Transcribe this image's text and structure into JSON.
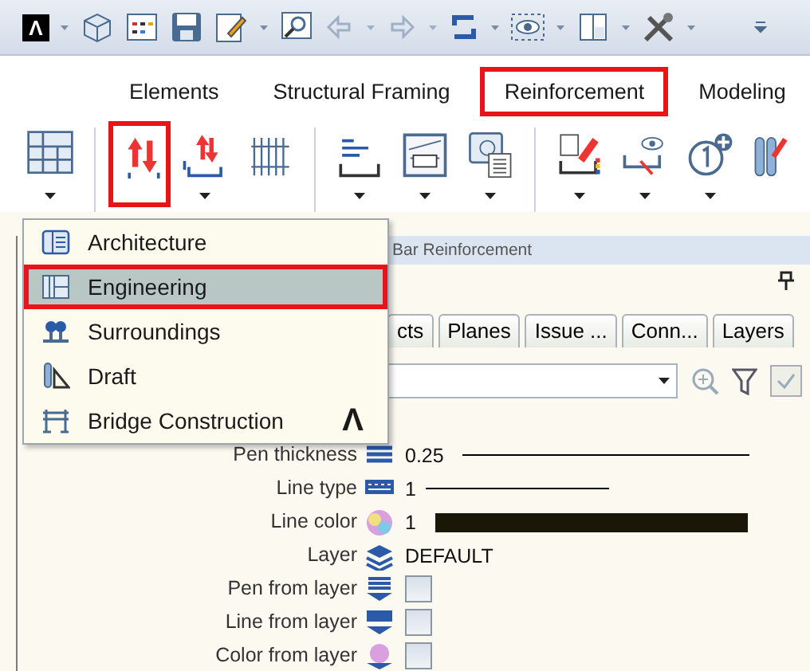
{
  "quick_access": {
    "logo": "Λ"
  },
  "tabs": [
    {
      "label": "Elements",
      "highlighted": false
    },
    {
      "label": "Structural Framing",
      "highlighted": false
    },
    {
      "label": "Reinforcement",
      "highlighted": true
    },
    {
      "label": "Modeling",
      "highlighted": false
    }
  ],
  "tool_groups": [
    [
      {
        "kind": "frame",
        "dropdown": true,
        "highlighted": false
      }
    ],
    [
      {
        "kind": "bars",
        "dropdown": false,
        "highlighted": true
      },
      {
        "kind": "bars-tray",
        "dropdown": true,
        "highlighted": false
      },
      {
        "kind": "mesh",
        "dropdown": false,
        "highlighted": false
      }
    ],
    [
      {
        "kind": "label",
        "dropdown": true,
        "highlighted": false
      },
      {
        "kind": "dimension",
        "dropdown": true,
        "highlighted": false
      },
      {
        "kind": "view",
        "dropdown": true,
        "highlighted": false
      }
    ],
    [
      {
        "kind": "edit",
        "dropdown": true,
        "highlighted": false
      },
      {
        "kind": "eye",
        "dropdown": true,
        "highlighted": false
      },
      {
        "kind": "number",
        "dropdown": true,
        "highlighted": false
      },
      {
        "kind": "bar-edit",
        "dropdown": false,
        "highlighted": false
      }
    ]
  ],
  "menu": {
    "logo": "Λ",
    "items": [
      {
        "kind": "architecture",
        "label": "Architecture",
        "selected": false,
        "highlighted": false
      },
      {
        "kind": "engineering",
        "label": "Engineering",
        "selected": true,
        "highlighted": true
      },
      {
        "kind": "surroundings",
        "label": "Surroundings",
        "selected": false,
        "highlighted": false
      },
      {
        "kind": "draft",
        "label": "Draft",
        "selected": false,
        "highlighted": false
      },
      {
        "kind": "bridge",
        "label": "Bridge Construction",
        "selected": false,
        "highlighted": false
      }
    ]
  },
  "group_label": "Bar Reinforcement",
  "palette_tabs": [
    "cts",
    "Planes",
    "Issue ...",
    "Conn...",
    "Layers"
  ],
  "properties": [
    {
      "kind": "line",
      "label": "Pen thickness",
      "value": "0.25"
    },
    {
      "kind": "line",
      "label": "Line type",
      "value": "1"
    },
    {
      "kind": "color",
      "label": "Line color",
      "value": "1",
      "color": "#1a1608"
    },
    {
      "kind": "text",
      "label": "Layer",
      "value": "DEFAULT"
    },
    {
      "kind": "checkbox",
      "label": "Pen from layer",
      "checked": false
    },
    {
      "kind": "checkbox",
      "label": "Line from layer",
      "checked": false
    },
    {
      "kind": "checkbox",
      "label": "Color from layer",
      "checked": false
    }
  ]
}
